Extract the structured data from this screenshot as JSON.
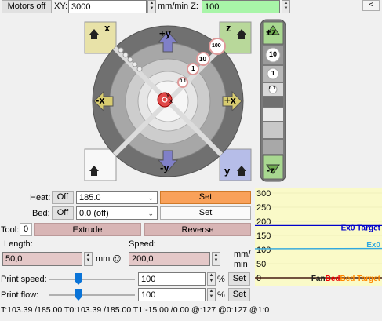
{
  "top": {
    "motors_off_label": "Motors off",
    "xy_label": "XY:",
    "xy_value": "3000",
    "unit_label": "mm/min Z:",
    "z_value": "100",
    "collapse_label": "<"
  },
  "jog": {
    "home_x": "x",
    "plus_y": "+y",
    "home_z": "z",
    "minus_x": "-x",
    "plus_x": "+x",
    "home_all": "",
    "minus_y": "-y",
    "home_y": "y",
    "step_100": "100",
    "step_10": "10",
    "step_1": "1",
    "step_01": "0.1",
    "center_label": "y",
    "center_label2": "x",
    "z_plus": "+z",
    "z_minus": "-z",
    "z_step_10": "10",
    "z_step_1": "1",
    "z_step_01": "0.1"
  },
  "heat": {
    "heat_label": "Heat:",
    "heat_off": "Off",
    "heat_value": "185.0",
    "heat_set": "Set",
    "bed_label": "Bed:",
    "bed_off": "Off",
    "bed_value": "0.0 (off)",
    "bed_set": "Set"
  },
  "extrude": {
    "tool_label": "Tool:",
    "tool_value": "0",
    "extrude_label": "Extrude",
    "reverse_label": "Reverse",
    "length_label": "Length:",
    "length_value": "50,0",
    "mm_at_label": "mm @",
    "speed_label": "Speed:",
    "speed_value": "200,0",
    "mm_min_label1": "mm/",
    "mm_min_label2": "min"
  },
  "print": {
    "speed_label": "Print speed:",
    "speed_value": "100",
    "speed_pct": 0.33,
    "flow_label": "Print flow:",
    "flow_value": "100",
    "flow_pct": 0.33,
    "percent": "%",
    "set_label": "Set"
  },
  "status": {
    "text": "T:103.39 /185.00 T0:103.39 /185.00 T1:-15.00 /0.00 @:127 @0:127 @1:0"
  },
  "colors": {
    "set_heat_bg": "#f9a15a",
    "z_field_bg": "#a8f5a8",
    "graph_bg": "#fafac8"
  },
  "chart_data": {
    "type": "line",
    "title": "",
    "xlabel": "",
    "ylabel": "",
    "ylim": [
      0,
      300
    ],
    "yticks": [
      "300",
      "250",
      "200",
      "150",
      "100",
      "50",
      "0"
    ],
    "series": [
      {
        "name": "Ex0 Target",
        "color": "#0000cc",
        "values": [
          185,
          185
        ]
      },
      {
        "name": "Ex0",
        "color": "#2fa8e0",
        "values": [
          103,
          104
        ]
      },
      {
        "name": "Bed Target",
        "color": "#ff8800",
        "values": [
          0,
          0
        ]
      },
      {
        "name": "Bed",
        "color": "#ee0000",
        "values": [
          0,
          0
        ]
      },
      {
        "name": "Fan",
        "color": "#222222",
        "values": [
          0,
          0
        ]
      }
    ],
    "legend_labels": {
      "ex0_target": "Ex0 Target",
      "ex0": "Ex0",
      "fan": "Fan",
      "bed": "Bed",
      "bed_target": "Bed Target"
    }
  }
}
